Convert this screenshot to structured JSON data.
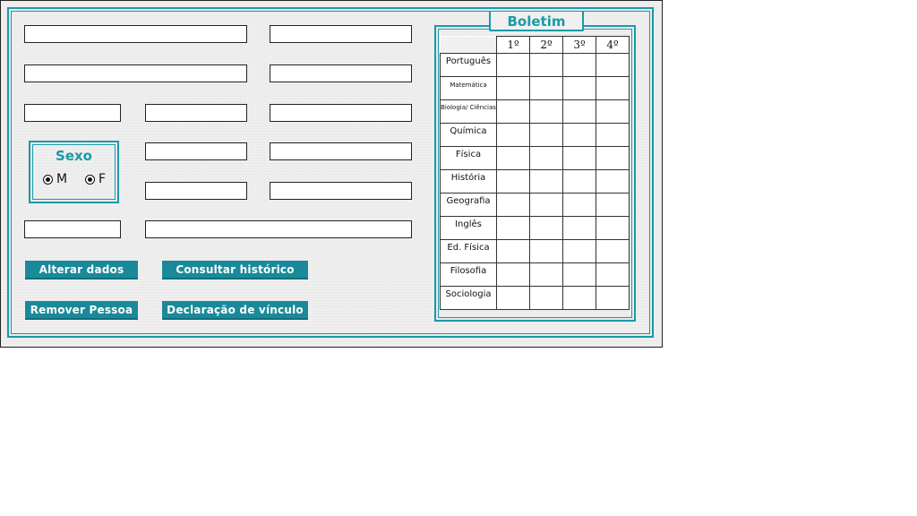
{
  "sexo": {
    "title": "Sexo",
    "options": [
      "M",
      "F"
    ]
  },
  "buttons": {
    "alterar": "Alterar dados",
    "consultar": "Consultar histórico",
    "remover": "Remover Pessoa",
    "declaracao": "Declaração de vínculo"
  },
  "boletim": {
    "title": "Boletim",
    "bimestres": [
      "1º",
      "2º",
      "3º",
      "4º"
    ],
    "subjects": [
      "Português",
      "Matemática",
      "Biologia/ Ciências",
      "Química",
      "Física",
      "História",
      "Geografia",
      "Inglês",
      "Ed. Física",
      "Filosofia",
      "Sociologia"
    ]
  },
  "colors": {
    "accent": "#1a9aa8",
    "button": "#1a8a9a"
  }
}
